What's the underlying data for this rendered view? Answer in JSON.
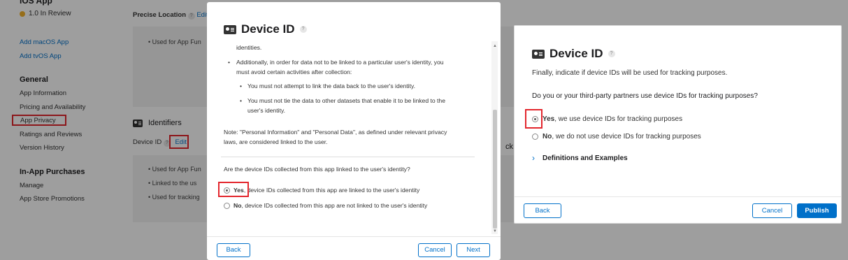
{
  "sidebar": {
    "app_name": "iOS App",
    "app_status": "1.0 In Review",
    "links": [
      "Add macOS App",
      "Add tvOS App"
    ],
    "general_heading": "General",
    "general_items": [
      "App Information",
      "Pricing and Availability",
      "App Privacy",
      "Ratings and Reviews",
      "Version History"
    ],
    "iap_heading": "In-App Purchases",
    "iap_items": [
      "Manage",
      "App Store Promotions"
    ]
  },
  "background": {
    "precise_location": "Precise Location",
    "edit_label": "Edit",
    "used_for_app_fun": "Used for App Fun",
    "identifiers_heading": "Identifiers",
    "device_id_label": "Device ID",
    "id_bullets": [
      "Used for App Fun",
      "Linked to the us",
      "Used for tracking"
    ],
    "partial_ck": "ck"
  },
  "modal1": {
    "title": "Device ID",
    "help": "?",
    "lines": [
      "identities.",
      "Additionally, in order for data not to be linked to a particular user's identity, you",
      "must avoid certain activities after collection:",
      "You must not attempt to link the data back to the user's identity.",
      "You must not tie the data to other datasets that enable it to be linked to the",
      "user's identity.",
      "Note: \"Personal Information\" and \"Personal Data\", as defined under relevant privacy",
      "laws, are considered linked to the user."
    ],
    "question": "Are the device IDs collected from this app linked to the user's identity?",
    "option_yes_bold": "Yes",
    "option_yes_rest": ", device IDs collected from this app are linked to the user's identity",
    "option_no_bold": "No",
    "option_no_rest": ", device IDs collected from this app are not linked to the user's identity",
    "back": "Back",
    "cancel": "Cancel",
    "next": "Next"
  },
  "modal2": {
    "title": "Device ID",
    "help": "?",
    "intro": "Finally, indicate if device IDs will be used for tracking purposes.",
    "question": "Do you or your third-party partners use device IDs for tracking purposes?",
    "option_yes_bold": "Yes",
    "option_yes_rest": ", we use device IDs for tracking purposes",
    "option_no_bold": "No",
    "option_no_rest": ", we do not use device IDs for tracking purposes",
    "definitions": "Definitions and Examples",
    "back": "Back",
    "cancel": "Cancel",
    "publish": "Publish"
  },
  "colors": {
    "accent": "#0070c9",
    "highlight": "#e3262d",
    "status": "#f3b22a"
  },
  "icons": [
    "id-card-icon",
    "help-icon",
    "chevron-right-icon",
    "status-dot-icon"
  ]
}
